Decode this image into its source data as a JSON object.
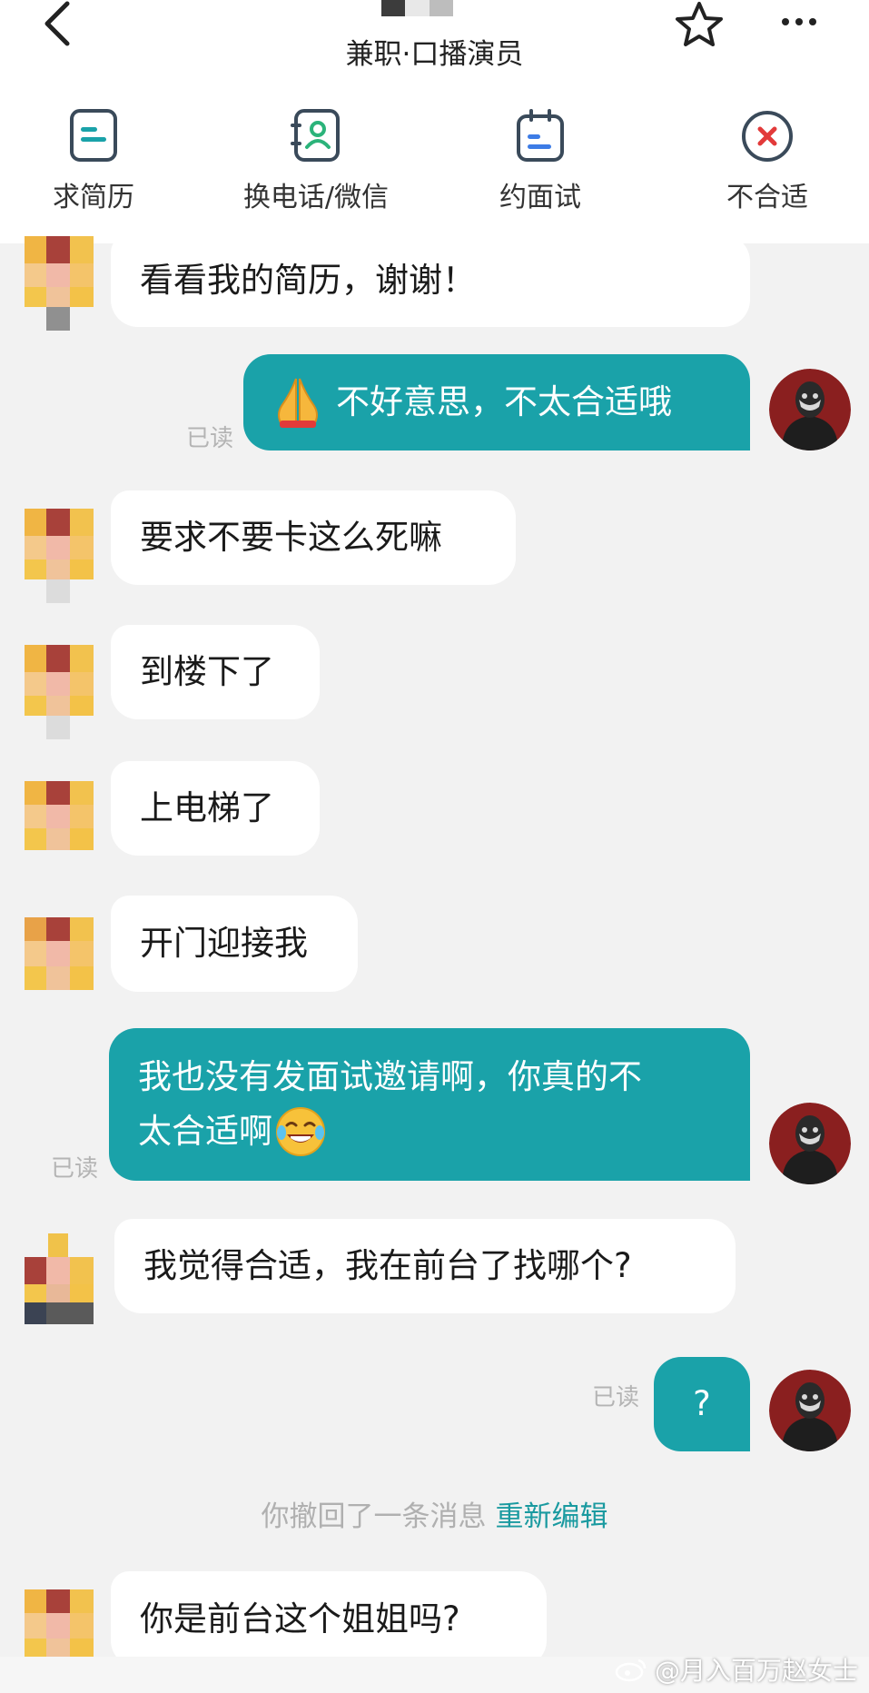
{
  "header": {
    "job_title": "兼职·口播演员",
    "actions": [
      {
        "label": "求简历",
        "icon": "resume-icon"
      },
      {
        "label": "换电话/微信",
        "icon": "contact-book-icon"
      },
      {
        "label": "约面试",
        "icon": "calendar-icon"
      },
      {
        "label": "不合适",
        "icon": "reject-icon"
      }
    ]
  },
  "messages": [
    {
      "side": "in",
      "text": "看看我的简历，谢谢！"
    },
    {
      "side": "out",
      "text": "不好意思，不太合适哦",
      "emoji": "pray-emoji",
      "status": "已读"
    },
    {
      "side": "in",
      "text": "要求不要卡这么死嘛"
    },
    {
      "side": "in",
      "text": "到楼下了"
    },
    {
      "side": "in",
      "text": "上电梯了"
    },
    {
      "side": "in",
      "text": "开门迎接我"
    },
    {
      "side": "out",
      "line1": "我也没有发面试邀请啊，你真的不",
      "line2": "太合适啊",
      "emoji": "laugh-cry-emoji",
      "status": "已读"
    },
    {
      "side": "in",
      "text": "我觉得合适，我在前台了找哪个?"
    },
    {
      "side": "out",
      "text": "?",
      "status": "已读"
    },
    {
      "side": "in",
      "text": "你是前台这个姐姐吗?"
    }
  ],
  "recall": {
    "text": "你撤回了一条消息",
    "action": "重新编辑"
  },
  "watermark": "@月入百万赵女士",
  "colors": {
    "accent": "#1aa2a9",
    "bubble_in": "#ffffff",
    "background": "#f2f2f2"
  }
}
